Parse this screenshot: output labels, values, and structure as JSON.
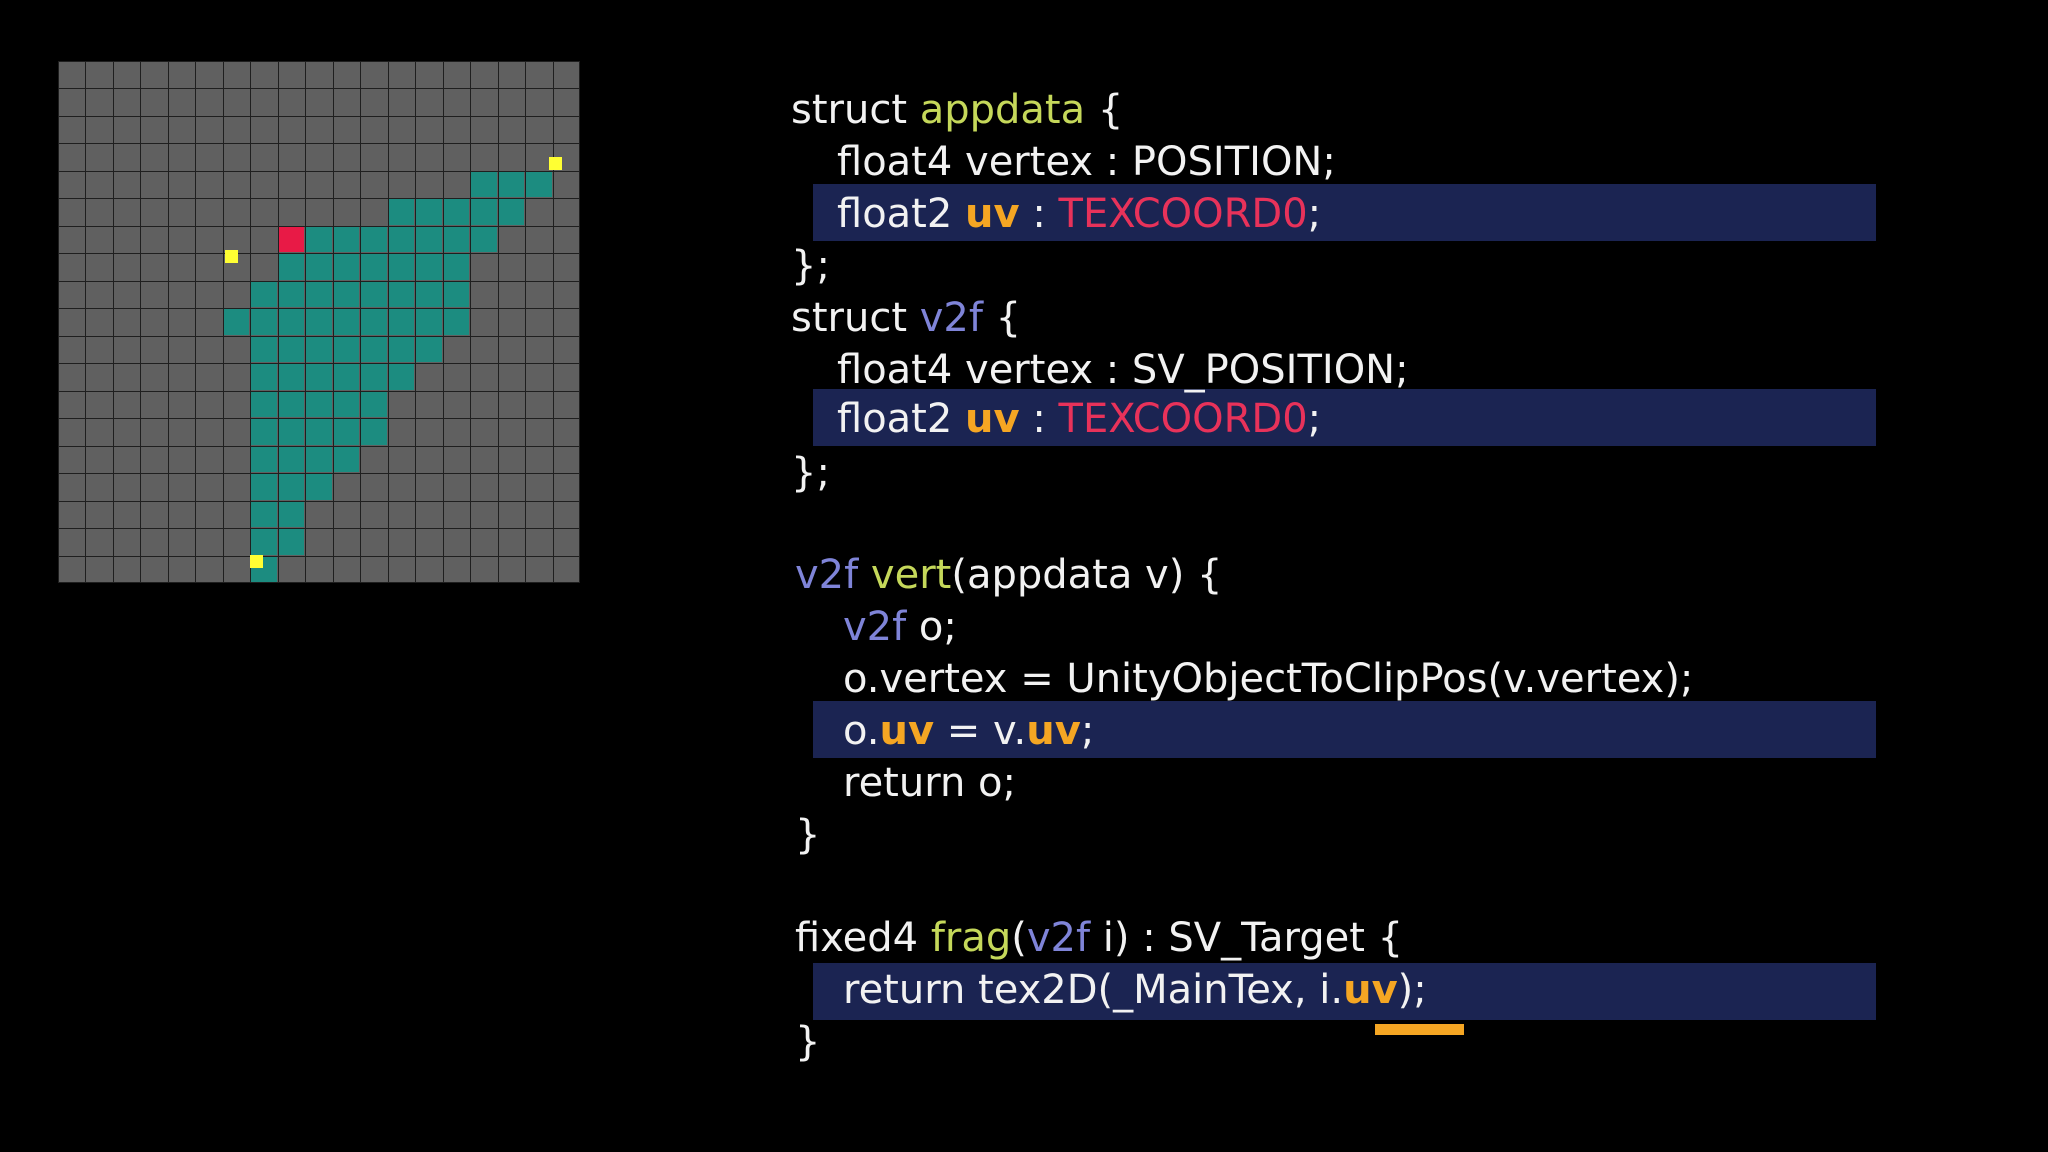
{
  "colors": {
    "background": "#000000",
    "grid_background": "#606060",
    "grid_line": "#1f1f1f",
    "filled_cell": "#1c8c80",
    "highlight_cell": "#e81a46",
    "vertex_marker": "#ffff33",
    "code_text": "#f2f2f2",
    "highlight_band": "#1b2452",
    "struct_name_color": "#c5d85a",
    "v2f_color": "#7f84d8",
    "uv_color": "#f5a623",
    "semantic_color": "#e8325a"
  },
  "grid": {
    "columns": 19,
    "rows": 19,
    "filled_cells": [
      [
        15,
        4
      ],
      [
        16,
        4
      ],
      [
        17,
        4
      ],
      [
        12,
        5
      ],
      [
        13,
        5
      ],
      [
        14,
        5
      ],
      [
        15,
        5
      ],
      [
        16,
        5
      ],
      [
        9,
        6
      ],
      [
        10,
        6
      ],
      [
        11,
        6
      ],
      [
        12,
        6
      ],
      [
        13,
        6
      ],
      [
        14,
        6
      ],
      [
        15,
        6
      ],
      [
        8,
        7
      ],
      [
        9,
        7
      ],
      [
        10,
        7
      ],
      [
        11,
        7
      ],
      [
        12,
        7
      ],
      [
        13,
        7
      ],
      [
        14,
        7
      ],
      [
        7,
        8
      ],
      [
        8,
        8
      ],
      [
        9,
        8
      ],
      [
        10,
        8
      ],
      [
        11,
        8
      ],
      [
        12,
        8
      ],
      [
        13,
        8
      ],
      [
        14,
        8
      ],
      [
        6,
        9
      ],
      [
        7,
        9
      ],
      [
        8,
        9
      ],
      [
        9,
        9
      ],
      [
        10,
        9
      ],
      [
        11,
        9
      ],
      [
        12,
        9
      ],
      [
        13,
        9
      ],
      [
        14,
        9
      ],
      [
        7,
        10
      ],
      [
        8,
        10
      ],
      [
        9,
        10
      ],
      [
        10,
        10
      ],
      [
        11,
        10
      ],
      [
        12,
        10
      ],
      [
        13,
        10
      ],
      [
        7,
        11
      ],
      [
        8,
        11
      ],
      [
        9,
        11
      ],
      [
        10,
        11
      ],
      [
        11,
        11
      ],
      [
        12,
        11
      ],
      [
        7,
        12
      ],
      [
        8,
        12
      ],
      [
        9,
        12
      ],
      [
        10,
        12
      ],
      [
        11,
        12
      ],
      [
        7,
        13
      ],
      [
        8,
        13
      ],
      [
        9,
        13
      ],
      [
        10,
        13
      ],
      [
        11,
        13
      ],
      [
        7,
        14
      ],
      [
        8,
        14
      ],
      [
        9,
        14
      ],
      [
        10,
        14
      ],
      [
        7,
        15
      ],
      [
        8,
        15
      ],
      [
        9,
        15
      ],
      [
        7,
        16
      ],
      [
        8,
        16
      ],
      [
        7,
        17
      ],
      [
        8,
        17
      ],
      [
        7,
        18
      ]
    ],
    "highlighted_cell": [
      8,
      6
    ],
    "vertex_markers": [
      [
        18.1,
        3.7
      ],
      [
        6.3,
        7.1
      ],
      [
        7.2,
        18.2
      ]
    ]
  },
  "code": {
    "struct_kw": "struct",
    "appdata_name": "appdata",
    "open_brace": "{",
    "close_struct": "};",
    "close_fn": "}",
    "float4_vertex_position": "float4 vertex : POSITION;",
    "float2_prefix": "float2",
    "uv": "uv",
    "colon": ":",
    "texcoord0": "TEXCOORD0",
    "semicolon": ";",
    "v2f_name": "v2f",
    "float4_vertex_sv_position": "float4 vertex : SV_POSITION;",
    "vert_name": "vert",
    "vert_params": "(appdata v) {",
    "o_decl": "o;",
    "o_vertex_assign": "o.vertex = UnityObjectToClipPos(v.vertex);",
    "o_prefix": "o.",
    "assign_v": " = v.",
    "return_o": "return o;",
    "fixed4": "fixed4",
    "frag_name": "frag",
    "open_paren": "(",
    "frag_param_tail": " i) : SV_Target {",
    "return_tex_prefix": "return tex2D(_MainTex, i.",
    "return_tex_suffix": ");"
  }
}
